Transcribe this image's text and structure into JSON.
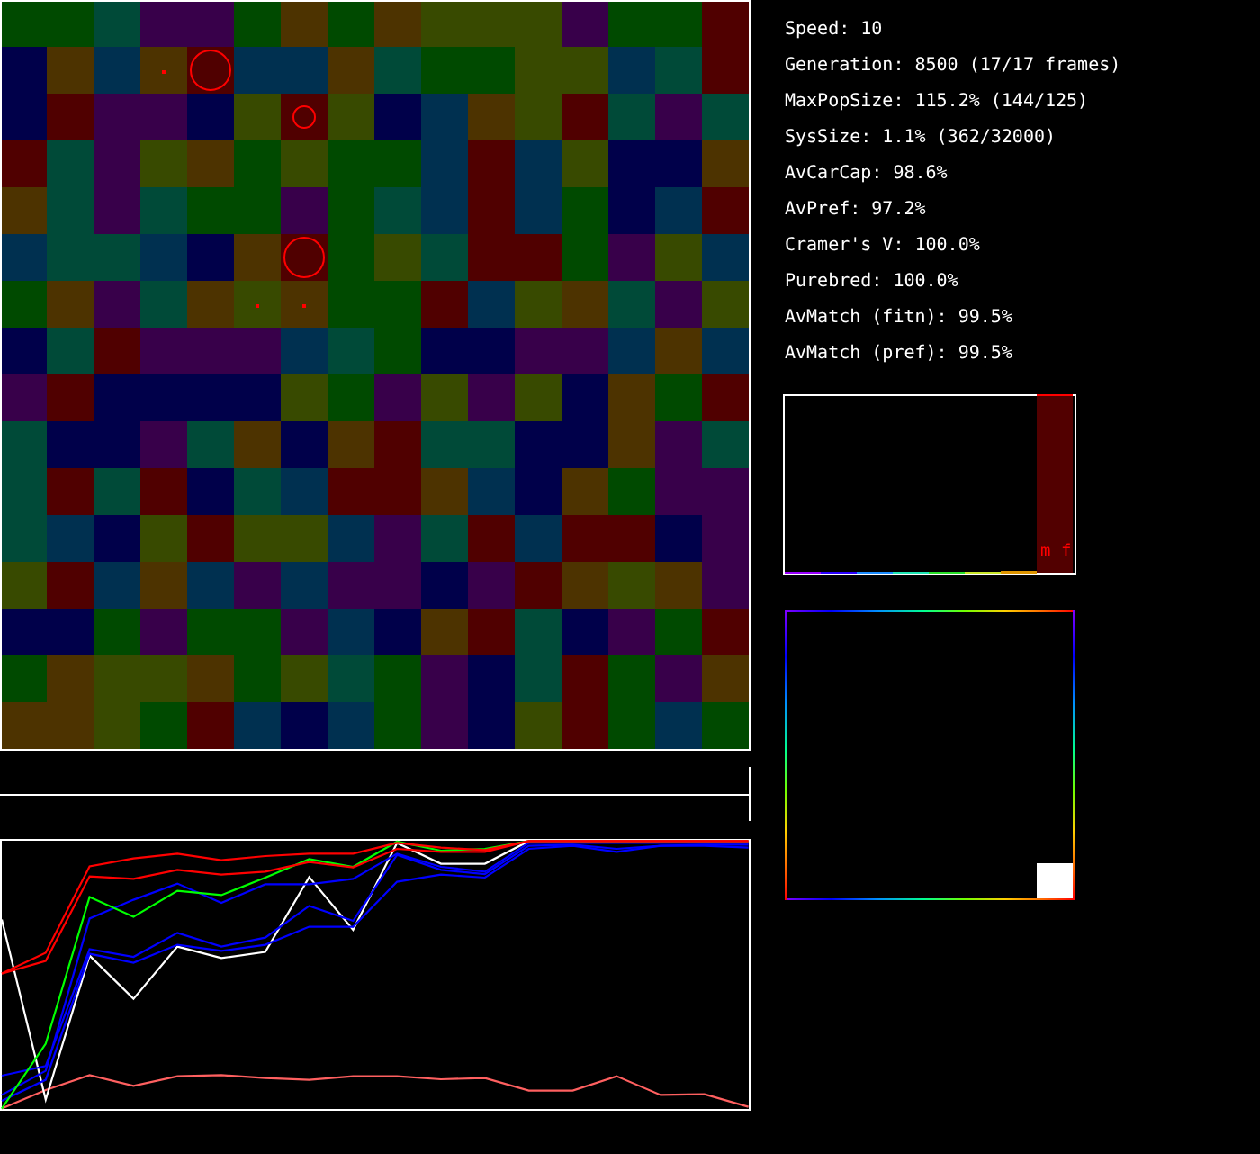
{
  "stats": [
    "Speed: 10",
    "Generation: 8500 (17/17 frames)",
    "MaxPopSize: 115.2% (144/125)",
    "SysSize: 1.1% (362/32000)",
    "AvCarCap: 98.6%",
    "AvPref: 97.2%",
    "Cramer's V: 100.0%",
    "Purebred: 100.0%",
    "AvMatch (fitn): 99.5%",
    "AvMatch (pref): 99.5%"
  ],
  "histogram": {
    "label": "m f"
  }
}
